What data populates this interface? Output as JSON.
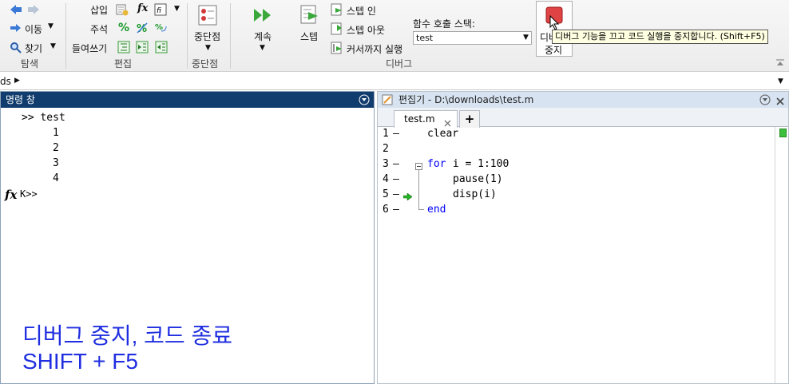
{
  "ribbon": {
    "nav": {
      "move_label": "이동",
      "find_label": "찾기",
      "group_label": "탐색"
    },
    "edit": {
      "insert_label": "삽입",
      "comment_label": "주석",
      "indent_label": "들여쓰기",
      "group_label": "편집",
      "fx_glyph": "fx",
      "percent_glyph": "%"
    },
    "breakpoints": {
      "label": "중단점",
      "group_label": "중단점"
    },
    "debug": {
      "continue_label": "계속",
      "step_label": "스텝",
      "step_in_label": "스텝 인",
      "step_out_label": "스텝 아웃",
      "run_to_cursor_label": "커서까지 실행",
      "group_label": "디버그"
    },
    "call_stack": {
      "label": "함수 호출 스택:",
      "selected": "test"
    },
    "stop": {
      "label_line1": "디버",
      "label_line2": "중지"
    }
  },
  "tooltip": "디버그 기능을 끄고 코드 실행을 중지합니다. (Shift+F5)",
  "address": {
    "text": "ds"
  },
  "command_window": {
    "title": "명령 창",
    "prompt_line": ">> test",
    "outputs": [
      "1",
      "2",
      "3",
      "4"
    ],
    "fx": "fx",
    "debug_prompt": "K>>"
  },
  "editor": {
    "title": "편집기 - D:\\downloads\\test.m",
    "tab_label": "test.m",
    "add_tab": "+",
    "lines": [
      {
        "num": "1",
        "mark": "–",
        "text": "clear"
      },
      {
        "num": "2",
        "mark": "",
        "text": ""
      },
      {
        "num": "3",
        "mark": "–",
        "kw": "for",
        "text": " i = 1:100"
      },
      {
        "num": "4",
        "mark": "–",
        "text": "pause(1)"
      },
      {
        "num": "5",
        "mark": "–",
        "text": "disp(i)"
      },
      {
        "num": "6",
        "mark": "–",
        "kw": "end",
        "text": ""
      }
    ]
  },
  "overlay": {
    "line1": "디버그 중지, 코드 종료",
    "line2": "SHIFT + F5"
  }
}
